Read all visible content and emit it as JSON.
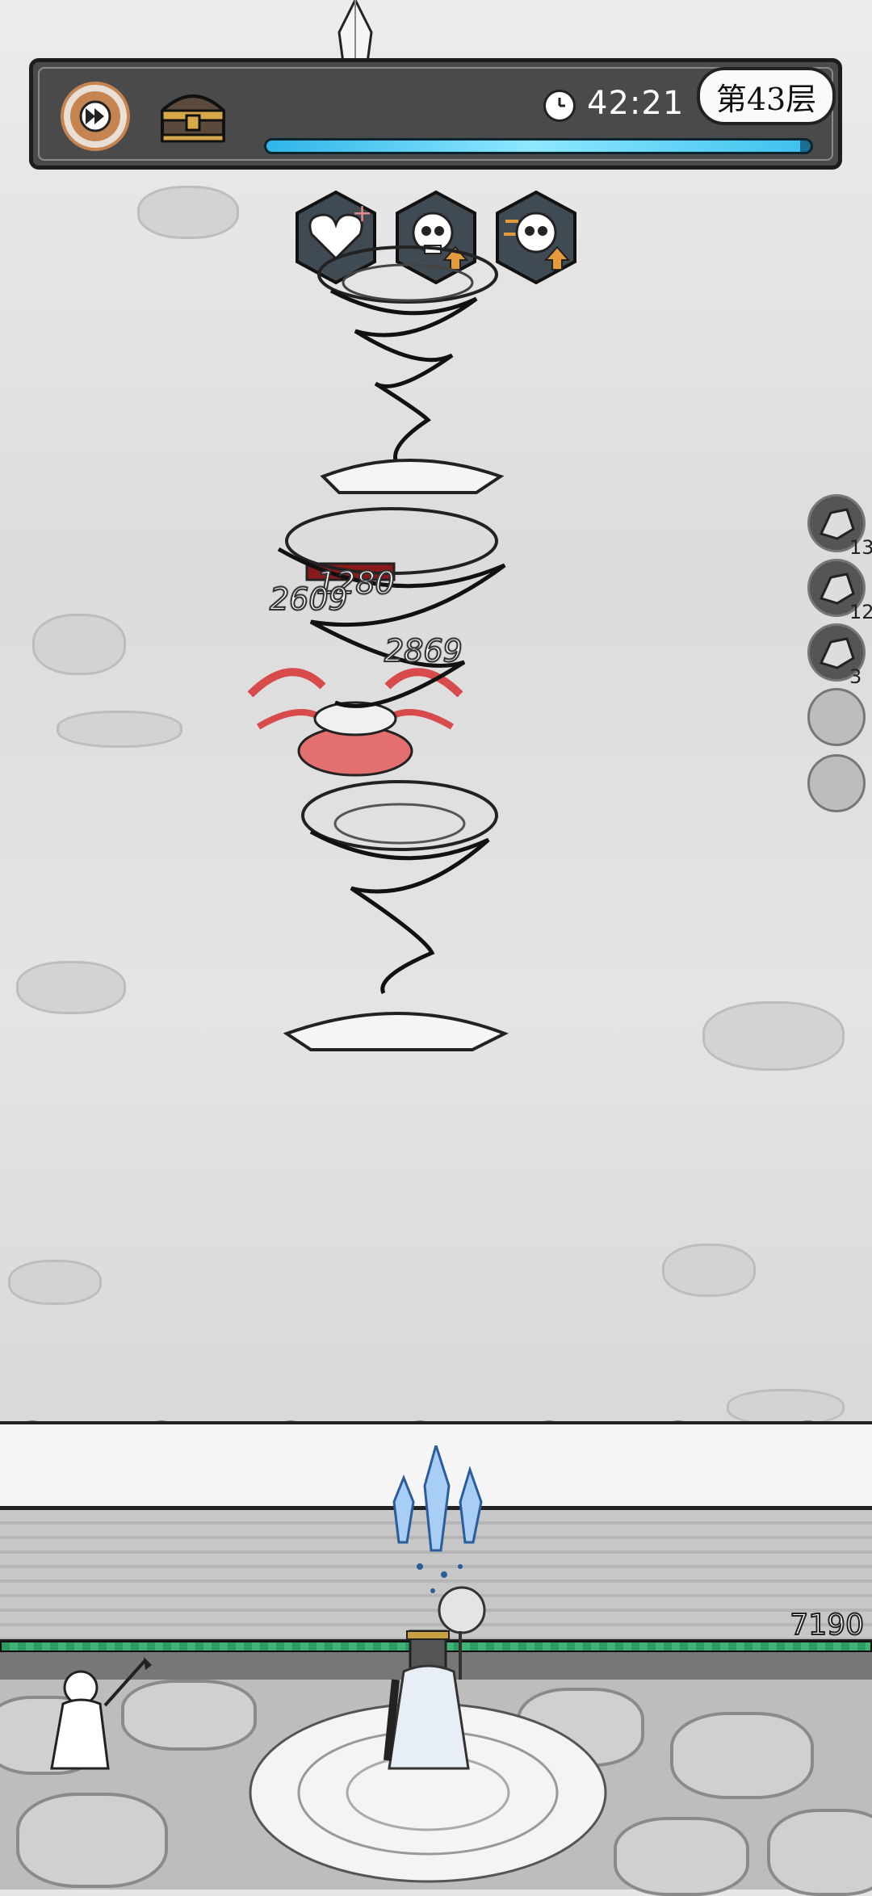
{
  "hud": {
    "fast_forward_icon": "fast-forward-icon",
    "chest_icon": "treasure-chest-icon",
    "clock_icon": "clock-icon",
    "timer": "42:21",
    "floor_label": "第43层",
    "progress": 0.98,
    "accent": "#c68550",
    "bar_color": "#2fb5e8"
  },
  "buffs": [
    {
      "icon": "heart-plus-icon"
    },
    {
      "icon": "skull-up-icon"
    },
    {
      "icon": "skull-speed-up-icon"
    }
  ],
  "side_skills": [
    {
      "icon": "rock-skill-icon",
      "count": "13"
    },
    {
      "icon": "ice-burst-skill-icon",
      "count": "12"
    },
    {
      "icon": "stone-wave-skill-icon",
      "count": "3"
    },
    {
      "icon": "empty-slot-icon",
      "count": ""
    },
    {
      "icon": "empty-slot-icon",
      "count": ""
    }
  ],
  "damage_numbers": [
    "1280",
    "2609",
    "2869"
  ],
  "player": {
    "hp_value": "7190",
    "hp_fraction": 1.0,
    "hp_color": "#2e9b62"
  }
}
